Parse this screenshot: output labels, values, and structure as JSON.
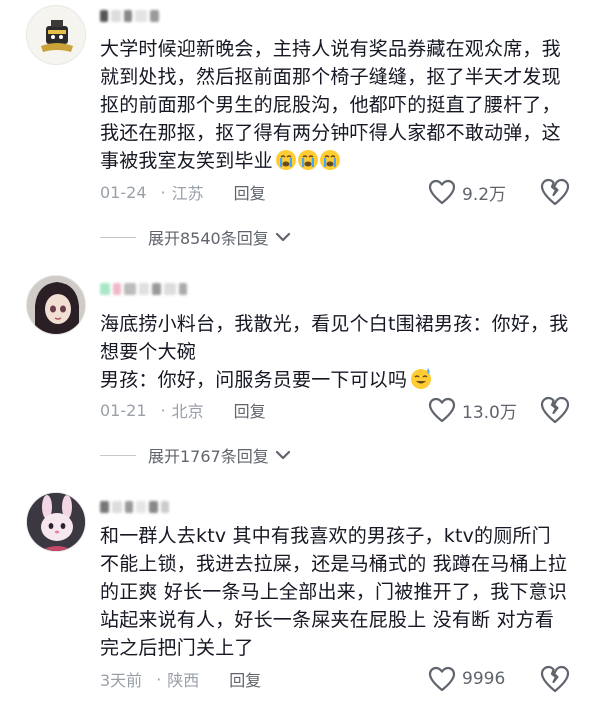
{
  "comments": [
    {
      "text": "大学时候迎新晚会，主持人说有奖品券藏在观众席，我就到处找，然后抠前面那个椅子缝缝，抠了半天才发现抠的前面那个男生的屁股沟，他都吓的挺直了腰杆了，我还在那抠，抠了得有两分钟吓得人家都不敢动弹，这事被我室友笑到毕业",
      "emoji": "crying-face-icon x3",
      "date": "01-24",
      "location": "江苏",
      "reply_label": "回复",
      "likes": "9.2万",
      "expand_label": "展开8540条回复"
    },
    {
      "text_line1": "海底捞小料台，我散光，看见个白t围裙男孩：你好，我想要个大碗",
      "text_line2": "男孩：你好，问服务员要一下可以吗",
      "emoji": "sweat-smile-icon",
      "date": "01-21",
      "location": "北京",
      "reply_label": "回复",
      "likes": "13.0万",
      "expand_label": "展开1767条回复"
    },
    {
      "text": "和一群人去ktv 其中有我喜欢的男孩子，ktv的厕所门不能上锁，我进去拉屎，还是马桶式的 我蹲在马桶上拉的正爽 好长一条马上全部出来，门被推开了，我下意识站起来说有人，好长一条屎夹在屁股上 没有断 对方看完之后把门关上了",
      "date": "3天前",
      "location": "陕西",
      "reply_label": "回复",
      "likes": "9996"
    }
  ],
  "colors": {
    "text": "#161823",
    "meta": "#9aa0a9",
    "action": "#60646c"
  }
}
